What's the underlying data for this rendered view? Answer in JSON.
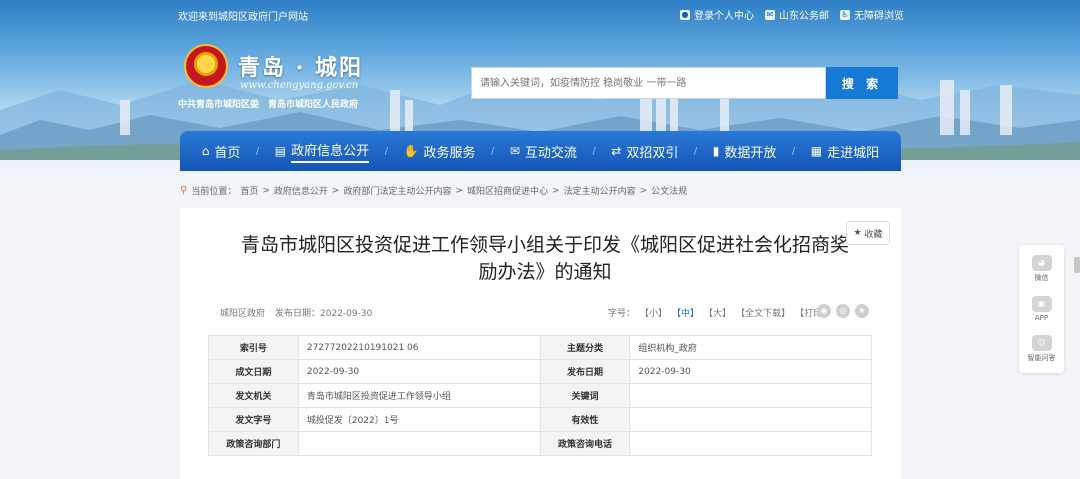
{
  "topbar": {
    "welcome": "欢迎来到城阳区政府门户网站",
    "login": "登录个人中心",
    "mail": "山东公务邮",
    "accessibility": "无障碍浏览"
  },
  "header": {
    "site_title": "青岛 · 城阳",
    "site_url": "www.chengyang.gov.cn",
    "site_sub": "中共青岛市城阳区委　青岛市城阳区人民政府"
  },
  "search": {
    "placeholder": "请输入关键词，如疫情防控 稳岗敬业 一带一路",
    "button": "搜 索"
  },
  "nav": {
    "items": [
      {
        "label": "首页",
        "icon": "home-icon",
        "glyph": "⌂"
      },
      {
        "label": "政府信息公开",
        "icon": "document-icon",
        "glyph": "▤"
      },
      {
        "label": "政务服务",
        "icon": "hand-icon",
        "glyph": "✋"
      },
      {
        "label": "互动交流",
        "icon": "chat-icon",
        "glyph": "✉"
      },
      {
        "label": "双招双引",
        "icon": "handshake-icon",
        "glyph": "⇄"
      },
      {
        "label": "数据开放",
        "icon": "bar-chart-icon",
        "glyph": "▮"
      },
      {
        "label": "走进城阳",
        "icon": "building-icon",
        "glyph": "▦"
      }
    ]
  },
  "breadcrumb": {
    "prefix": "当前位置：",
    "items": [
      "首页",
      "政府信息公开",
      "政府部门法定主动公开内容",
      "城阳区招商促进中心",
      "法定主动公开内容",
      "公文法规"
    ]
  },
  "document": {
    "title": "青岛市城阳区投资促进工作领导小组关于印发《城阳区促进社会化招商奖励办法》的通知",
    "favorite": "收藏",
    "source": "城阳区政府",
    "publish": "发布日期：2022-09-30",
    "font_label": "字号：",
    "font_small": "【小】",
    "font_medium": "【中】",
    "font_large": "【大】",
    "download": "【全文下载】",
    "print": "【打印】"
  },
  "info_table": [
    [
      "索引号",
      "27277202210191021 06",
      "主题分类",
      "组织机构_政府"
    ],
    [
      "成文日期",
      "2022-09-30",
      "发布日期",
      "2022-09-30"
    ],
    [
      "发文机关",
      "青岛市城阳区投资促进工作领导小组",
      "关键词",
      ""
    ],
    [
      "发文字号",
      "城投促发〔2022〕1号",
      "有效性",
      ""
    ],
    [
      "政策咨询部门",
      "",
      "政策咨询电话",
      ""
    ]
  ],
  "float_panel": {
    "wechat": "微信",
    "app": "APP",
    "ai": "智能问答"
  },
  "colors": {
    "nav_blue": "#1a66c8",
    "search_button": "#1579d6",
    "accent_orange": "#e0742e"
  }
}
